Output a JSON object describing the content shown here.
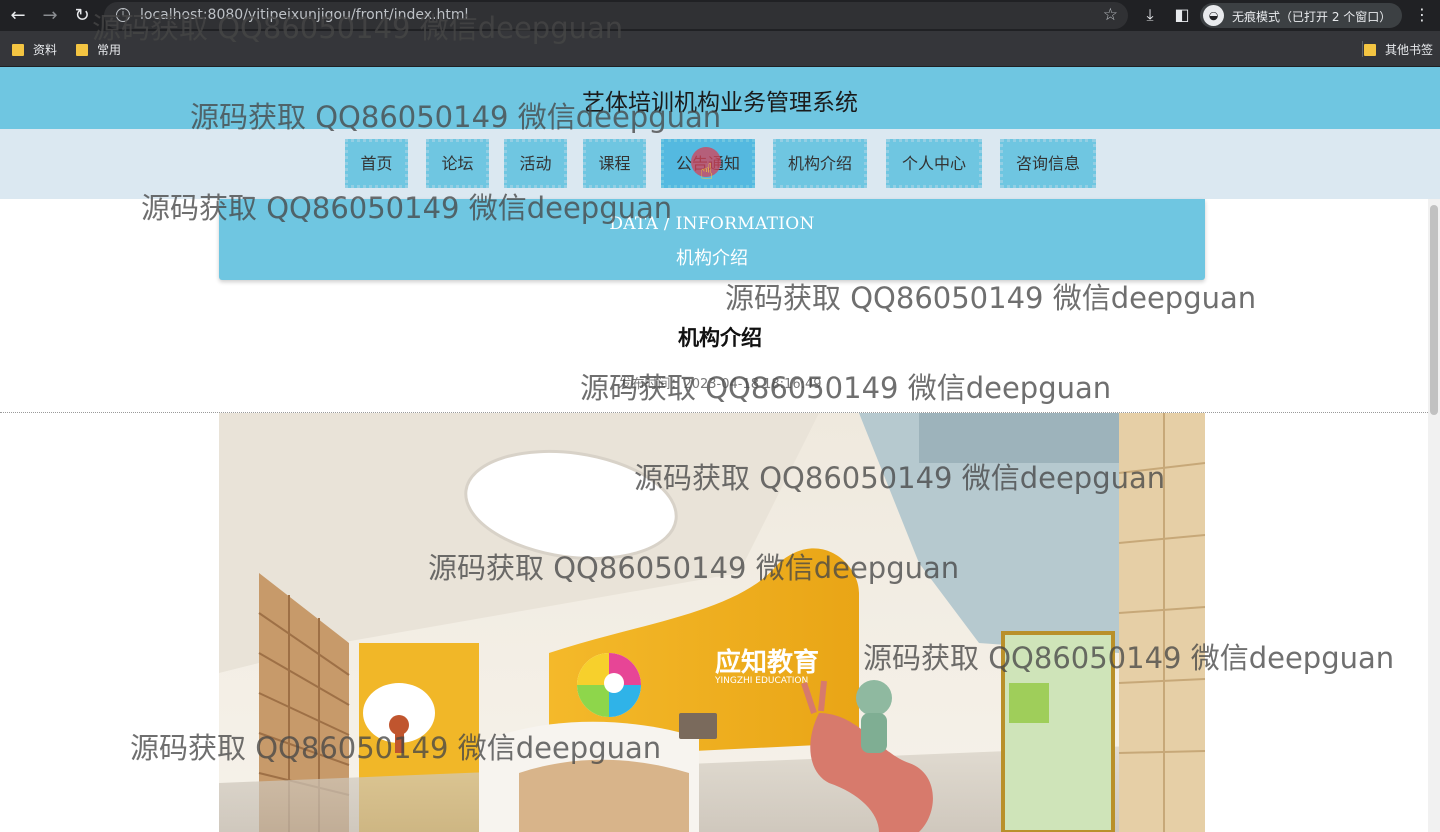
{
  "browser": {
    "url": "localhost:8080/yitipeixunjigou/front/index.html",
    "incognito_label": "无痕模式（已打开 2 个窗口）",
    "bookmarks": [
      "资料",
      "常用"
    ],
    "other_bookmarks": "其他书签"
  },
  "site": {
    "title": "艺体培训机构业务管理系统",
    "nav": [
      "首页",
      "论坛",
      "活动",
      "课程",
      "公告通知",
      "机构介绍",
      "个人中心",
      "咨询信息"
    ],
    "active_nav": "公告通知"
  },
  "banner": {
    "en": "DATA / INFORMATION",
    "cn": "机构介绍"
  },
  "article": {
    "title": "机构介绍",
    "date": "发布时间：2023-04-18 18:16:49"
  },
  "photo": {
    "sign_cn": "应知教育",
    "sign_en": "YINGZHI EDUCATION"
  },
  "watermark": "源码获取 QQ86050149 微信deepguan",
  "colors": {
    "header": "#6fc6e1",
    "nav_bg": "#dbe8f1",
    "active": "#54b9e0"
  }
}
